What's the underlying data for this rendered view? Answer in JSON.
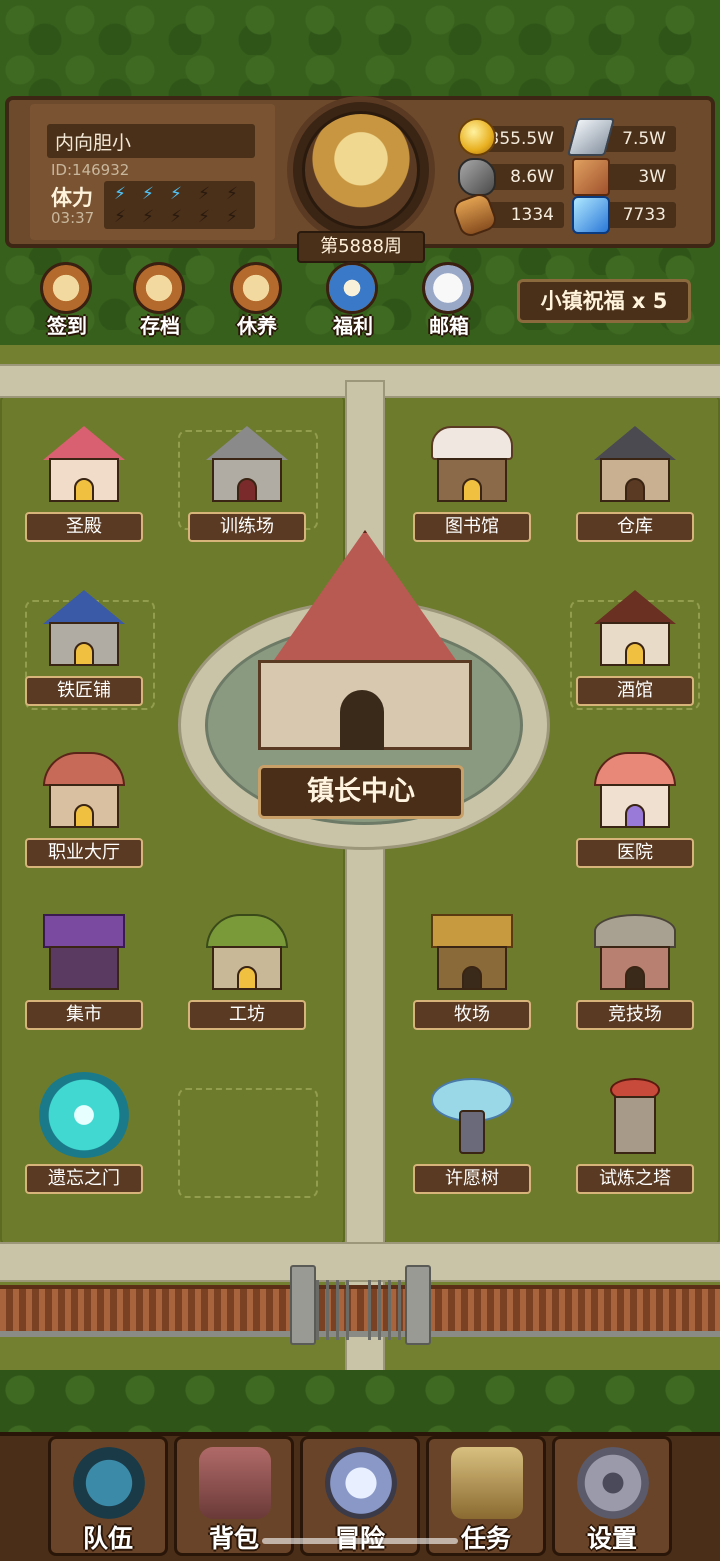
{
  "player": {
    "name": "内向胆小",
    "id": "ID:146932",
    "stamina_label": "体力",
    "stamina_timer": "03:37",
    "stamina_filled": 3,
    "stamina_max": 10,
    "week": "第5888周"
  },
  "resources": {
    "gold": "355.5W",
    "iron": "7.5W",
    "stone": "8.6W",
    "leather": "3W",
    "wood": "1334",
    "crystal": "7733"
  },
  "top_buttons": {
    "signin": "签到",
    "save": "存档",
    "rest": "休养",
    "welfare": "福利",
    "mail": "邮箱"
  },
  "blessing": "小镇祝福 x 5",
  "buildings": {
    "temple": "圣殿",
    "training": "训练场",
    "library": "图书馆",
    "warehouse": "仓库",
    "smithy": "铁匠铺",
    "tavern": "酒馆",
    "town_hall": "镇长中心",
    "job_hall": "职业大厅",
    "hospital": "医院",
    "market": "集市",
    "workshop": "工坊",
    "ranch": "牧场",
    "arena": "竞技场",
    "portal": "遗忘之门",
    "wish_tree": "许愿树",
    "tower": "试炼之塔"
  },
  "nav": {
    "team": "队伍",
    "bag": "背包",
    "adventure": "冒险",
    "quest": "任务",
    "settings": "设置"
  },
  "colors": {
    "wood_dark": "#4a3019",
    "grass": "#72802f",
    "path": "#c9c4a8",
    "stamina_bolt": "#4fc3f7"
  }
}
